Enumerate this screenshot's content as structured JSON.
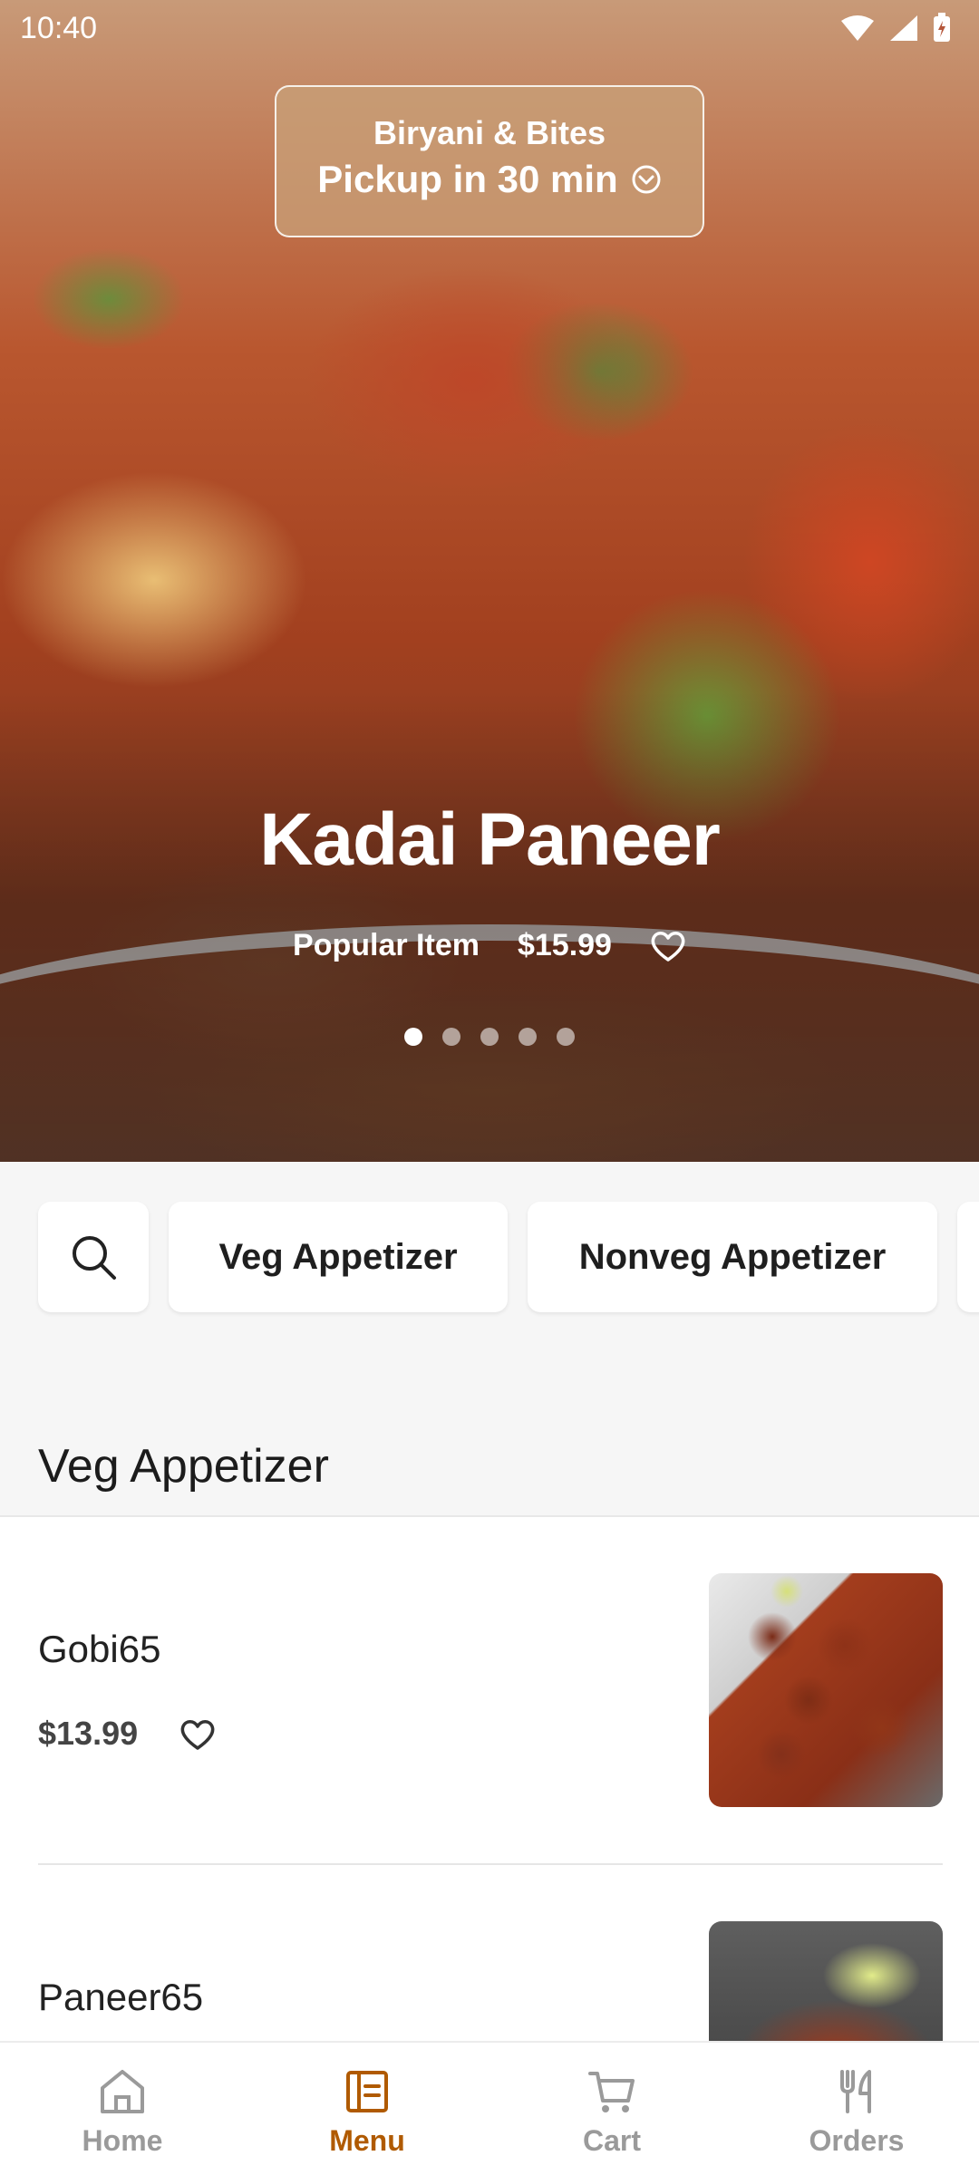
{
  "status_bar": {
    "time": "10:40"
  },
  "store": {
    "name": "Biryani & Bites",
    "pickup": "Pickup in 30 min"
  },
  "hero": {
    "title": "Kadai Paneer",
    "tag": "Popular Item",
    "price": "$15.99",
    "slides": 5,
    "active_slide": 1
  },
  "categories": [
    {
      "label": "Veg Appetizer"
    },
    {
      "label": "Nonveg Appetizer"
    }
  ],
  "section": {
    "title": "Veg Appetizer"
  },
  "items": [
    {
      "name": "Gobi65",
      "price": "$13.99"
    },
    {
      "name": "Paneer65",
      "price": ""
    }
  ],
  "nav": [
    {
      "label": "Home",
      "icon": "home-icon"
    },
    {
      "label": "Menu",
      "icon": "menu-icon"
    },
    {
      "label": "Cart",
      "icon": "cart-icon"
    },
    {
      "label": "Orders",
      "icon": "orders-icon"
    }
  ],
  "colors": {
    "accent": "#b05a00",
    "inactive": "#9a9a9a"
  }
}
